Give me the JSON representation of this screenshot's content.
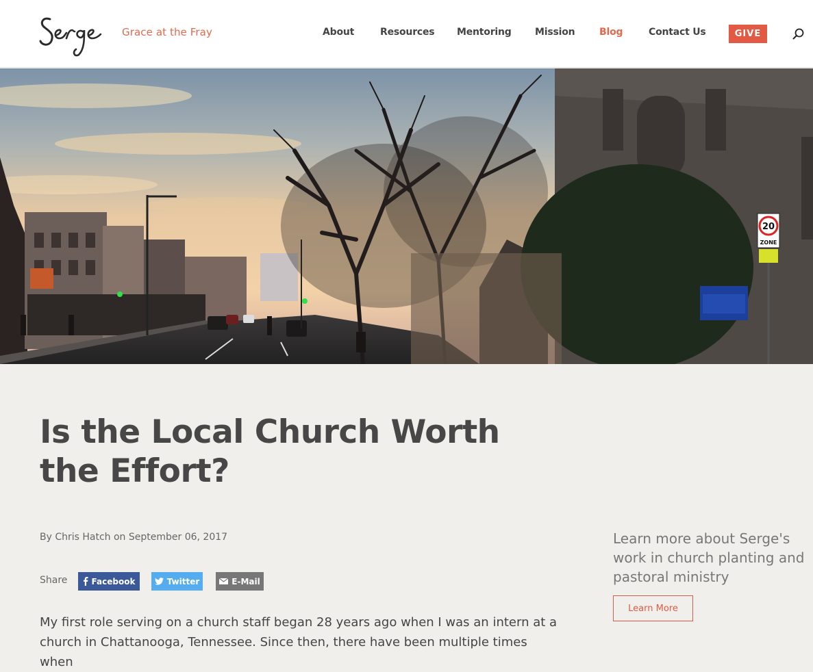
{
  "site": {
    "logo_text": "Serge",
    "tagline": "Grace at the Fray"
  },
  "nav": {
    "items": [
      {
        "label": "About",
        "active": false
      },
      {
        "label": "Resources",
        "active": false
      },
      {
        "label": "Mentoring",
        "active": false
      },
      {
        "label": "Mission",
        "active": false
      },
      {
        "label": "Blog",
        "active": true
      },
      {
        "label": "Contact Us",
        "active": false
      }
    ],
    "give_label": "GIVE",
    "search_icon": "search-icon"
  },
  "hero": {
    "speed_sign_number": "20",
    "speed_sign_label": "ZONE"
  },
  "article": {
    "title": "Is the Local Church Worth the Effort?",
    "byline": "By Chris Hatch on September 06, 2017",
    "share_label": "Share",
    "share_buttons": {
      "facebook": "Facebook",
      "twitter": "Twitter",
      "email": "E-Mail"
    },
    "body": "My first role serving on a church staff began 28 years ago when I was an intern at a church in Chattanooga, Tennessee. Since then, there have been multiple times when"
  },
  "sidebar": {
    "promo_text": "Learn more about Serge's work in church planting and pastoral ministry",
    "button_label": "Learn More"
  },
  "colors": {
    "accent": "#e25a43",
    "page_bg": "#f1efeb",
    "facebook": "#3b5998",
    "twitter": "#55acee",
    "email": "#777777"
  }
}
